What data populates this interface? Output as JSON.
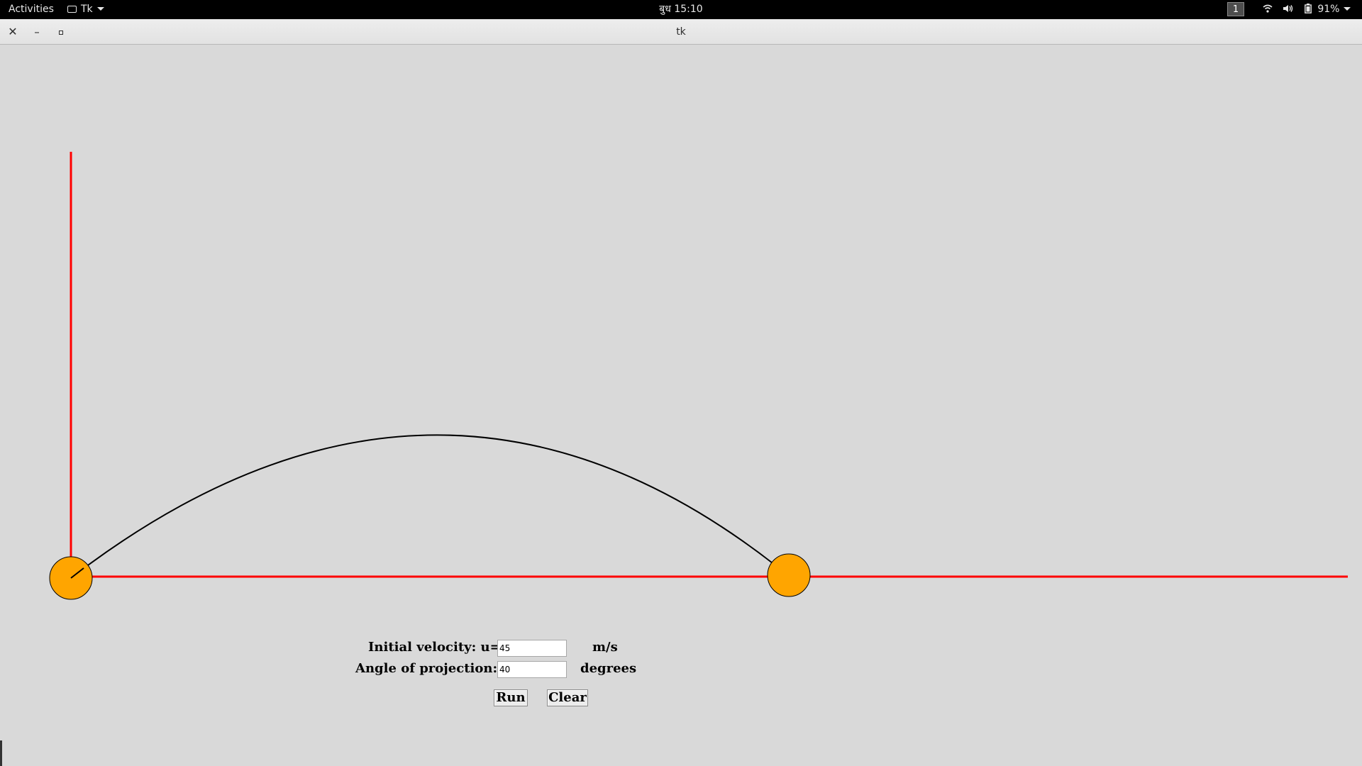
{
  "topbar": {
    "activities": "Activities",
    "app_name": "Tk",
    "clock": "बुध 15:10",
    "workspace": "1",
    "battery": "91%"
  },
  "window": {
    "title": "tk",
    "close_glyph": "✕",
    "minimize_glyph": "–"
  },
  "form": {
    "velocity_label": "Initial velocity: u=",
    "velocity_value": "45",
    "velocity_unit": "m/s",
    "angle_label": "Angle of projection: θ=",
    "angle_value": "40",
    "angle_unit": "degrees",
    "run_label": "Run",
    "clear_label": "Clear"
  },
  "colors": {
    "axis": "#ff0000",
    "ball_fill": "#ffa500",
    "trajectory": "#000000",
    "background": "#d9d9d9"
  },
  "icons": [
    "app-window-icon",
    "wifi-icon",
    "volume-icon",
    "battery-icon",
    "close-icon",
    "minimize-icon",
    "maximize-icon"
  ]
}
